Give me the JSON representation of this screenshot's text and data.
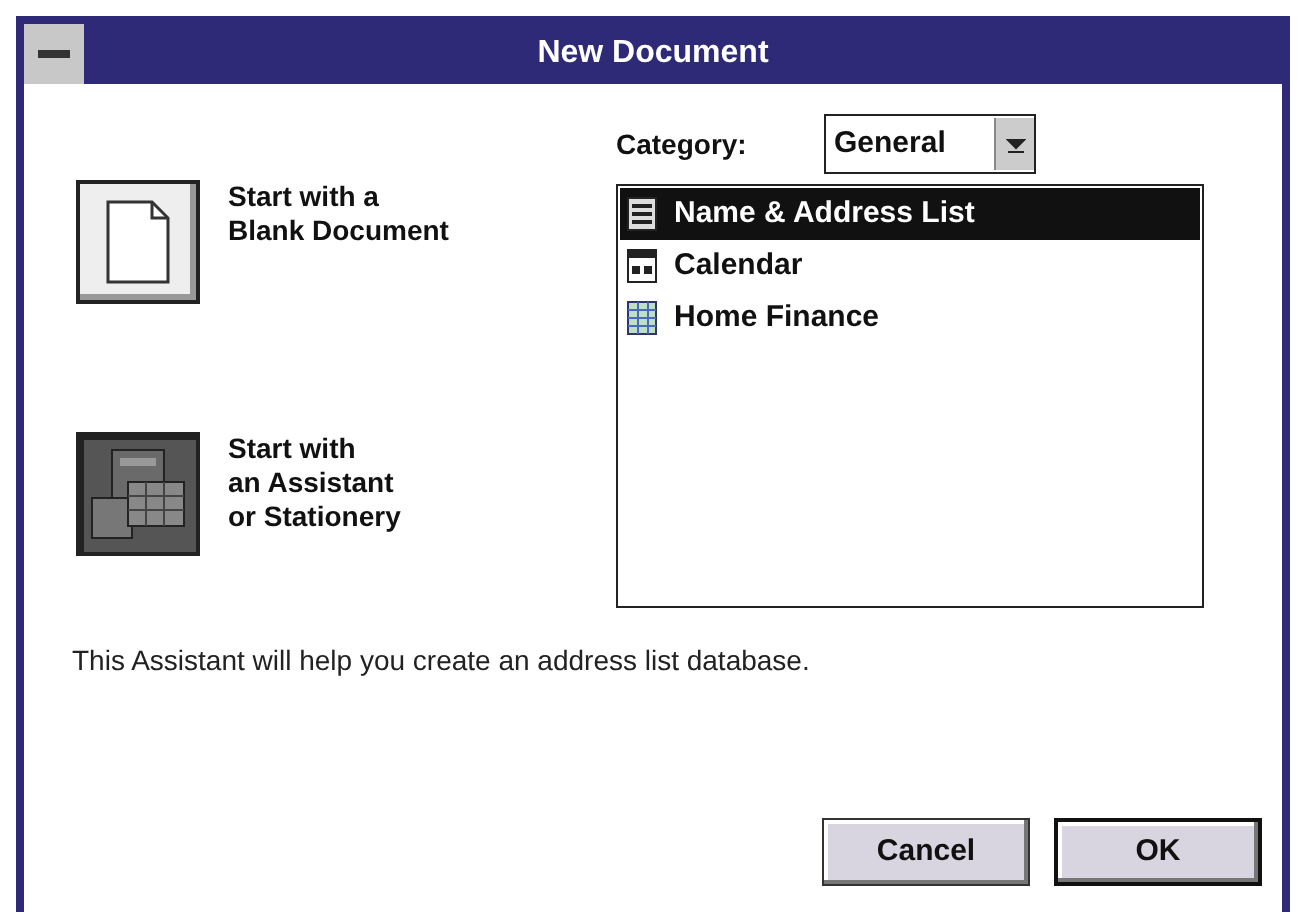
{
  "window": {
    "title": "New Document"
  },
  "start_options": [
    {
      "label_lines": [
        "Start with a",
        "Blank Document"
      ],
      "kind": "blank",
      "selected": false
    },
    {
      "label_lines": [
        "Start with",
        "an Assistant",
        "or Stationery"
      ],
      "kind": "assistant",
      "selected": true
    }
  ],
  "category": {
    "label": "Category:",
    "value": "General"
  },
  "templates": [
    {
      "label": "Name & Address List",
      "kind": "list",
      "selected": true
    },
    {
      "label": "Calendar",
      "kind": "calendar",
      "selected": false
    },
    {
      "label": "Home Finance",
      "kind": "spreadsheet",
      "selected": false
    }
  ],
  "description": "This Assistant will help you create an address list database.",
  "buttons": [
    {
      "label": "Cancel",
      "default": false
    },
    {
      "label": "OK",
      "default": true
    }
  ]
}
